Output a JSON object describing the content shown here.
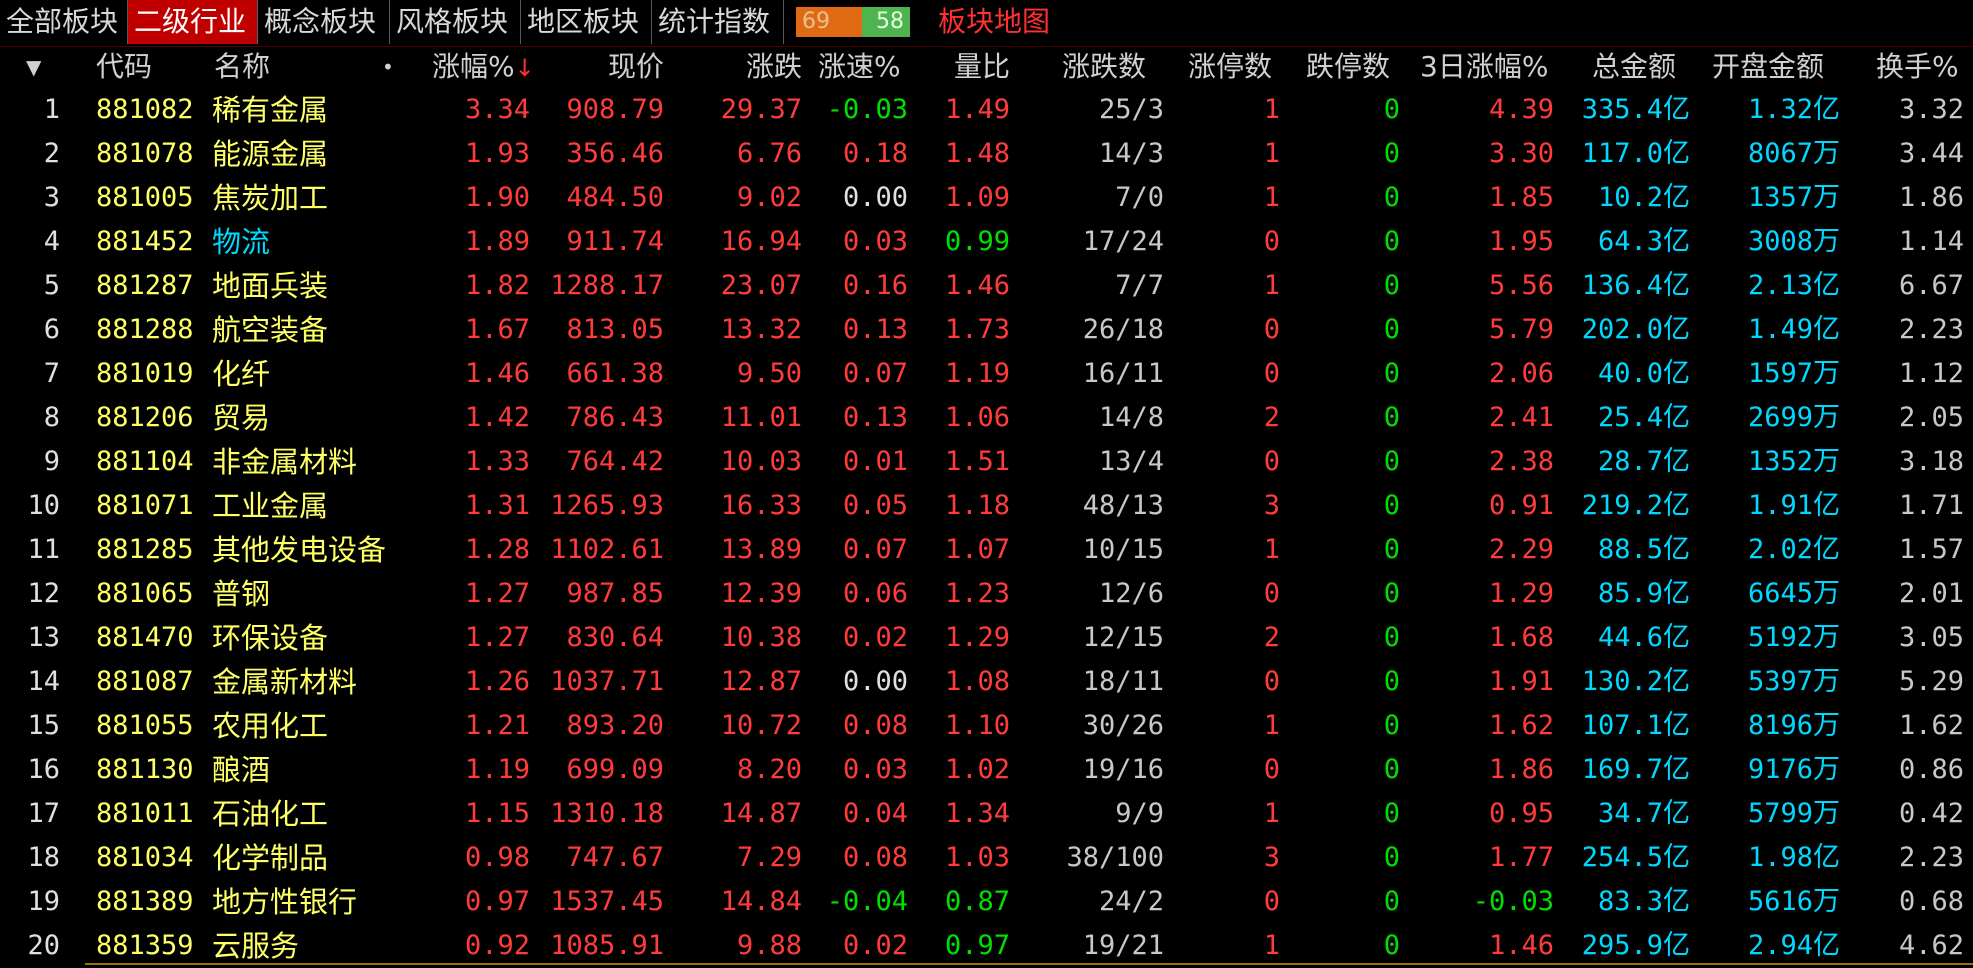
{
  "tabs": [
    {
      "label": "全部板块",
      "active": false
    },
    {
      "label": "二级行业",
      "active": true
    },
    {
      "label": "概念板块",
      "active": false
    },
    {
      "label": "风格板块",
      "active": false
    },
    {
      "label": "地区板块",
      "active": false
    },
    {
      "label": "统计指数",
      "active": false
    }
  ],
  "stats": {
    "up": "69",
    "down": "58"
  },
  "map_link": "板块地图",
  "columns": {
    "dropdown": "▼",
    "code": "代码",
    "name": "名称",
    "dot": "•",
    "change_pct": "涨幅%",
    "sort_arrow": "↓",
    "price": "现价",
    "change": "涨跌",
    "speed": "涨速%",
    "vol_ratio": "量比",
    "updown": "涨跌数",
    "limit_up": "涨停数",
    "limit_down": "跌停数",
    "change3d": "3日涨幅%",
    "amount": "总金额",
    "open_amount": "开盘金额",
    "turnover": "换手%"
  },
  "colors": {
    "rise": "#ff3c3c",
    "fall": "#00e000",
    "code": "#ffff66",
    "amount": "#00d8ff",
    "active_tab": "#c00000"
  },
  "rows": [
    {
      "no": "1",
      "code": "881082",
      "name": "稀有金属",
      "name_color": "yellow",
      "pct": "3.34",
      "price": "908.79",
      "chg": "29.37",
      "speed": "-0.03",
      "speed_color": "green",
      "vr": "1.49",
      "vr_color": "red",
      "ud": "25/3",
      "lu": "1",
      "lu_color": "red",
      "ld": "0",
      "c3": "4.39",
      "c3_color": "red",
      "amt": "335.4亿",
      "oamt": "1.32亿",
      "turn": "3.32"
    },
    {
      "no": "2",
      "code": "881078",
      "name": "能源金属",
      "name_color": "yellow",
      "pct": "1.93",
      "price": "356.46",
      "chg": "6.76",
      "speed": "0.18",
      "speed_color": "red",
      "vr": "1.48",
      "vr_color": "red",
      "ud": "14/3",
      "lu": "1",
      "lu_color": "red",
      "ld": "0",
      "c3": "3.30",
      "c3_color": "red",
      "amt": "117.0亿",
      "oamt": "8067万",
      "turn": "3.44"
    },
    {
      "no": "3",
      "code": "881005",
      "name": "焦炭加工",
      "name_color": "yellow",
      "pct": "1.90",
      "price": "484.50",
      "chg": "9.02",
      "speed": "0.00",
      "speed_color": "white",
      "vr": "1.09",
      "vr_color": "red",
      "ud": "7/0",
      "lu": "1",
      "lu_color": "red",
      "ld": "0",
      "c3": "1.85",
      "c3_color": "red",
      "amt": "10.2亿",
      "oamt": "1357万",
      "turn": "1.86"
    },
    {
      "no": "4",
      "code": "881452",
      "name": "物流",
      "name_color": "cyan",
      "pct": "1.89",
      "price": "911.74",
      "chg": "16.94",
      "speed": "0.03",
      "speed_color": "red",
      "vr": "0.99",
      "vr_color": "green",
      "ud": "17/24",
      "lu": "0",
      "lu_color": "red",
      "ld": "0",
      "c3": "1.95",
      "c3_color": "red",
      "amt": "64.3亿",
      "oamt": "3008万",
      "turn": "1.14"
    },
    {
      "no": "5",
      "code": "881287",
      "name": "地面兵装",
      "name_color": "yellow",
      "pct": "1.82",
      "price": "1288.17",
      "chg": "23.07",
      "speed": "0.16",
      "speed_color": "red",
      "vr": "1.46",
      "vr_color": "red",
      "ud": "7/7",
      "lu": "1",
      "lu_color": "red",
      "ld": "0",
      "c3": "5.56",
      "c3_color": "red",
      "amt": "136.4亿",
      "oamt": "2.13亿",
      "turn": "6.67"
    },
    {
      "no": "6",
      "code": "881288",
      "name": "航空装备",
      "name_color": "yellow",
      "pct": "1.67",
      "price": "813.05",
      "chg": "13.32",
      "speed": "0.13",
      "speed_color": "red",
      "vr": "1.73",
      "vr_color": "red",
      "ud": "26/18",
      "lu": "0",
      "lu_color": "red",
      "ld": "0",
      "c3": "5.79",
      "c3_color": "red",
      "amt": "202.0亿",
      "oamt": "1.49亿",
      "turn": "2.23"
    },
    {
      "no": "7",
      "code": "881019",
      "name": "化纤",
      "name_color": "yellow",
      "pct": "1.46",
      "price": "661.38",
      "chg": "9.50",
      "speed": "0.07",
      "speed_color": "red",
      "vr": "1.19",
      "vr_color": "red",
      "ud": "16/11",
      "lu": "0",
      "lu_color": "red",
      "ld": "0",
      "c3": "2.06",
      "c3_color": "red",
      "amt": "40.0亿",
      "oamt": "1597万",
      "turn": "1.12"
    },
    {
      "no": "8",
      "code": "881206",
      "name": "贸易",
      "name_color": "yellow",
      "pct": "1.42",
      "price": "786.43",
      "chg": "11.01",
      "speed": "0.13",
      "speed_color": "red",
      "vr": "1.06",
      "vr_color": "red",
      "ud": "14/8",
      "lu": "2",
      "lu_color": "red",
      "ld": "0",
      "c3": "2.41",
      "c3_color": "red",
      "amt": "25.4亿",
      "oamt": "2699万",
      "turn": "2.05"
    },
    {
      "no": "9",
      "code": "881104",
      "name": "非金属材料",
      "name_color": "yellow",
      "pct": "1.33",
      "price": "764.42",
      "chg": "10.03",
      "speed": "0.01",
      "speed_color": "red",
      "vr": "1.51",
      "vr_color": "red",
      "ud": "13/4",
      "lu": "0",
      "lu_color": "red",
      "ld": "0",
      "c3": "2.38",
      "c3_color": "red",
      "amt": "28.7亿",
      "oamt": "1352万",
      "turn": "3.18"
    },
    {
      "no": "10",
      "code": "881071",
      "name": "工业金属",
      "name_color": "yellow",
      "pct": "1.31",
      "price": "1265.93",
      "chg": "16.33",
      "speed": "0.05",
      "speed_color": "red",
      "vr": "1.18",
      "vr_color": "red",
      "ud": "48/13",
      "lu": "3",
      "lu_color": "red",
      "ld": "0",
      "c3": "0.91",
      "c3_color": "red",
      "amt": "219.2亿",
      "oamt": "1.91亿",
      "turn": "1.71"
    },
    {
      "no": "11",
      "code": "881285",
      "name": "其他发电设备",
      "name_color": "yellow",
      "pct": "1.28",
      "price": "1102.61",
      "chg": "13.89",
      "speed": "0.07",
      "speed_color": "red",
      "vr": "1.07",
      "vr_color": "red",
      "ud": "10/15",
      "lu": "1",
      "lu_color": "red",
      "ld": "0",
      "c3": "2.29",
      "c3_color": "red",
      "amt": "88.5亿",
      "oamt": "2.02亿",
      "turn": "1.57"
    },
    {
      "no": "12",
      "code": "881065",
      "name": "普钢",
      "name_color": "yellow",
      "pct": "1.27",
      "price": "987.85",
      "chg": "12.39",
      "speed": "0.06",
      "speed_color": "red",
      "vr": "1.23",
      "vr_color": "red",
      "ud": "12/6",
      "lu": "0",
      "lu_color": "red",
      "ld": "0",
      "c3": "1.29",
      "c3_color": "red",
      "amt": "85.9亿",
      "oamt": "6645万",
      "turn": "2.01"
    },
    {
      "no": "13",
      "code": "881470",
      "name": "环保设备",
      "name_color": "yellow",
      "pct": "1.27",
      "price": "830.64",
      "chg": "10.38",
      "speed": "0.02",
      "speed_color": "red",
      "vr": "1.29",
      "vr_color": "red",
      "ud": "12/15",
      "lu": "2",
      "lu_color": "red",
      "ld": "0",
      "c3": "1.68",
      "c3_color": "red",
      "amt": "44.6亿",
      "oamt": "5192万",
      "turn": "3.05"
    },
    {
      "no": "14",
      "code": "881087",
      "name": "金属新材料",
      "name_color": "yellow",
      "pct": "1.26",
      "price": "1037.71",
      "chg": "12.87",
      "speed": "0.00",
      "speed_color": "white",
      "vr": "1.08",
      "vr_color": "red",
      "ud": "18/11",
      "lu": "0",
      "lu_color": "red",
      "ld": "0",
      "c3": "1.91",
      "c3_color": "red",
      "amt": "130.2亿",
      "oamt": "5397万",
      "turn": "5.29"
    },
    {
      "no": "15",
      "code": "881055",
      "name": "农用化工",
      "name_color": "yellow",
      "pct": "1.21",
      "price": "893.20",
      "chg": "10.72",
      "speed": "0.08",
      "speed_color": "red",
      "vr": "1.10",
      "vr_color": "red",
      "ud": "30/26",
      "lu": "1",
      "lu_color": "red",
      "ld": "0",
      "c3": "1.62",
      "c3_color": "red",
      "amt": "107.1亿",
      "oamt": "8196万",
      "turn": "1.62"
    },
    {
      "no": "16",
      "code": "881130",
      "name": "酿酒",
      "name_color": "yellow",
      "pct": "1.19",
      "price": "699.09",
      "chg": "8.20",
      "speed": "0.03",
      "speed_color": "red",
      "vr": "1.02",
      "vr_color": "red",
      "ud": "19/16",
      "lu": "0",
      "lu_color": "red",
      "ld": "0",
      "c3": "1.86",
      "c3_color": "red",
      "amt": "169.7亿",
      "oamt": "9176万",
      "turn": "0.86"
    },
    {
      "no": "17",
      "code": "881011",
      "name": "石油化工",
      "name_color": "yellow",
      "pct": "1.15",
      "price": "1310.18",
      "chg": "14.87",
      "speed": "0.04",
      "speed_color": "red",
      "vr": "1.34",
      "vr_color": "red",
      "ud": "9/9",
      "lu": "1",
      "lu_color": "red",
      "ld": "0",
      "c3": "0.95",
      "c3_color": "red",
      "amt": "34.7亿",
      "oamt": "5799万",
      "turn": "0.42"
    },
    {
      "no": "18",
      "code": "881034",
      "name": "化学制品",
      "name_color": "yellow",
      "pct": "0.98",
      "price": "747.67",
      "chg": "7.29",
      "speed": "0.08",
      "speed_color": "red",
      "vr": "1.03",
      "vr_color": "red",
      "ud": "38/100",
      "lu": "3",
      "lu_color": "red",
      "ld": "0",
      "c3": "1.77",
      "c3_color": "red",
      "amt": "254.5亿",
      "oamt": "1.98亿",
      "turn": "2.23"
    },
    {
      "no": "19",
      "code": "881389",
      "name": "地方性银行",
      "name_color": "yellow",
      "pct": "0.97",
      "price": "1537.45",
      "chg": "14.84",
      "speed": "-0.04",
      "speed_color": "green",
      "vr": "0.87",
      "vr_color": "green",
      "ud": "24/2",
      "lu": "0",
      "lu_color": "red",
      "ld": "0",
      "c3": "-0.03",
      "c3_color": "green",
      "amt": "83.3亿",
      "oamt": "5616万",
      "turn": "0.68"
    },
    {
      "no": "20",
      "code": "881359",
      "name": "云服务",
      "name_color": "yellow",
      "pct": "0.92",
      "price": "1085.91",
      "chg": "9.88",
      "speed": "0.02",
      "speed_color": "red",
      "vr": "0.97",
      "vr_color": "green",
      "ud": "19/21",
      "lu": "1",
      "lu_color": "red",
      "ld": "0",
      "c3": "1.46",
      "c3_color": "red",
      "amt": "295.9亿",
      "oamt": "2.94亿",
      "turn": "4.62"
    }
  ]
}
